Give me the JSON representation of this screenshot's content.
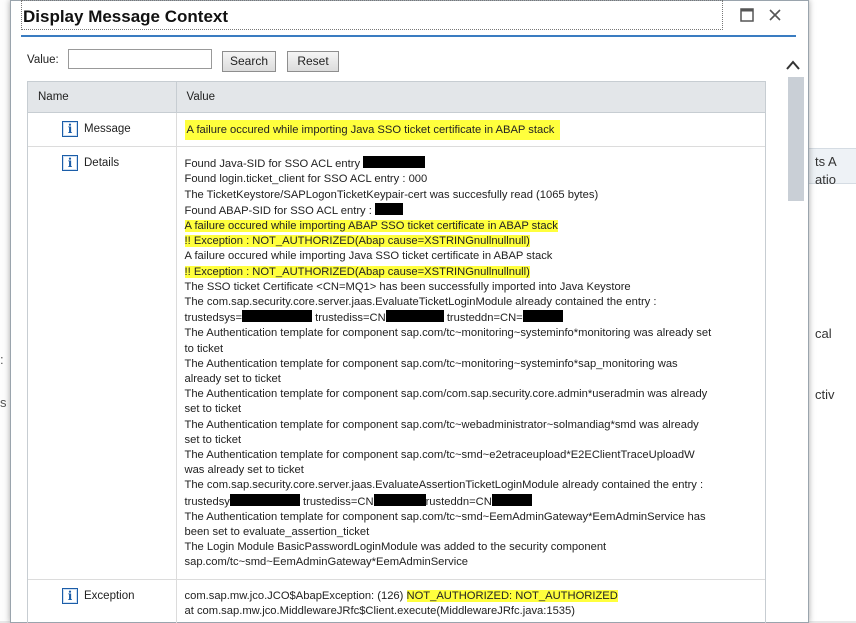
{
  "background": {
    "right_fragments": [
      "ts A",
      "atio",
      "cal",
      "ctiv"
    ]
  },
  "dialog": {
    "title": "Display Message Context",
    "maximize_icon": "maximize-icon",
    "close_icon": "close-icon"
  },
  "toolbar": {
    "value_label": "Value:",
    "value_input": "",
    "search_label": "Search",
    "reset_label": "Reset"
  },
  "table": {
    "headers": {
      "name": "Name",
      "value": "Value"
    },
    "rows": [
      {
        "name": "Message",
        "lines": [
          {
            "text": "A failure occured while importing Java SSO ticket certificate in ABAP stack",
            "highlight": true
          }
        ]
      },
      {
        "name": "Details",
        "lines": [
          {
            "text": "Found Java-SID for SSO ACL entry ",
            "redact": 62
          },
          {
            "text": "Found login.ticket_client for SSO ACL entry : 000"
          },
          {
            "text": "The TicketKeystore/SAPLogonTicketKeypair-cert was succesfully read (1065 bytes)"
          },
          {
            "text": "Found ABAP-SID for SSO ACL entry : ",
            "redact": 28
          },
          {
            "text": "A failure occured while importing ABAP SSO ticket certificate in ABAP stack",
            "highlight": true
          },
          {
            "text": "!! Exception : NOT_AUTHORIZED(Abap cause=XSTRINGnullnullnull)",
            "highlight": true
          },
          {
            "text": "A failure occured while importing Java SSO ticket certificate in ABAP stack"
          },
          {
            "text": "!! Exception : NOT_AUTHORIZED(Abap cause=XSTRINGnullnullnull)",
            "highlight": true
          },
          {
            "text": "The SSO ticket Certificate <CN=MQ1> has been successfully imported into Java Keystore"
          },
          {
            "text": "The com.sap.security.core.server.jaas.EvaluateTicketLoginModule already contained the entry :"
          },
          {
            "segments": [
              "trustedsys=",
              "#70",
              " trustediss=CN",
              "#58",
              " trusteddn=CN=",
              "#40"
            ]
          },
          {
            "text": "The Authentication template for component sap.com/tc~monitoring~systeminfo*monitoring was already set"
          },
          {
            "text": "to ticket"
          },
          {
            "text": "The Authentication template for component sap.com/tc~monitoring~systeminfo*sap_monitoring was"
          },
          {
            "text": "already set to ticket"
          },
          {
            "text": "The Authentication template for component sap.com/com.sap.security.core.admin*useradmin was already"
          },
          {
            "text": "set to ticket"
          },
          {
            "text": "The Authentication template for component sap.com/tc~webadministrator~solmandiag*smd was already"
          },
          {
            "text": "set to ticket"
          },
          {
            "text": "The Authentication template for component sap.com/tc~smd~e2etraceupload*E2EClientTraceUploadW"
          },
          {
            "text": "was already set to ticket"
          },
          {
            "text": "The com.sap.security.core.server.jaas.EvaluateAssertionTicketLoginModule already contained the entry :"
          },
          {
            "segments": [
              "trustedsy",
              "#70",
              " trustediss=CN",
              "#52",
              "rusteddn=CN",
              "#40"
            ]
          },
          {
            "text": "The Authentication template for component sap.com/tc~smd~EemAdminGateway*EemAdminService has"
          },
          {
            "text": "been set to evaluate_assertion_ticket"
          },
          {
            "text": "The Login Module BasicPasswordLoginModule was added to the security component"
          },
          {
            "text": "sap.com/tc~smd~EemAdminGateway*EemAdminService"
          }
        ]
      },
      {
        "name": "Exception",
        "lines": [
          {
            "segments": [
              "com.sap.mw.jco.JCO$AbapException: (126) ",
              "!NOT_AUTHORIZED: NOT_AUTHORIZED"
            ]
          },
          {
            "text": "at com.sap.mw.jco.MiddlewareJRfc$Client.execute(MiddlewareJRfc.java:1535)"
          }
        ]
      }
    ]
  }
}
